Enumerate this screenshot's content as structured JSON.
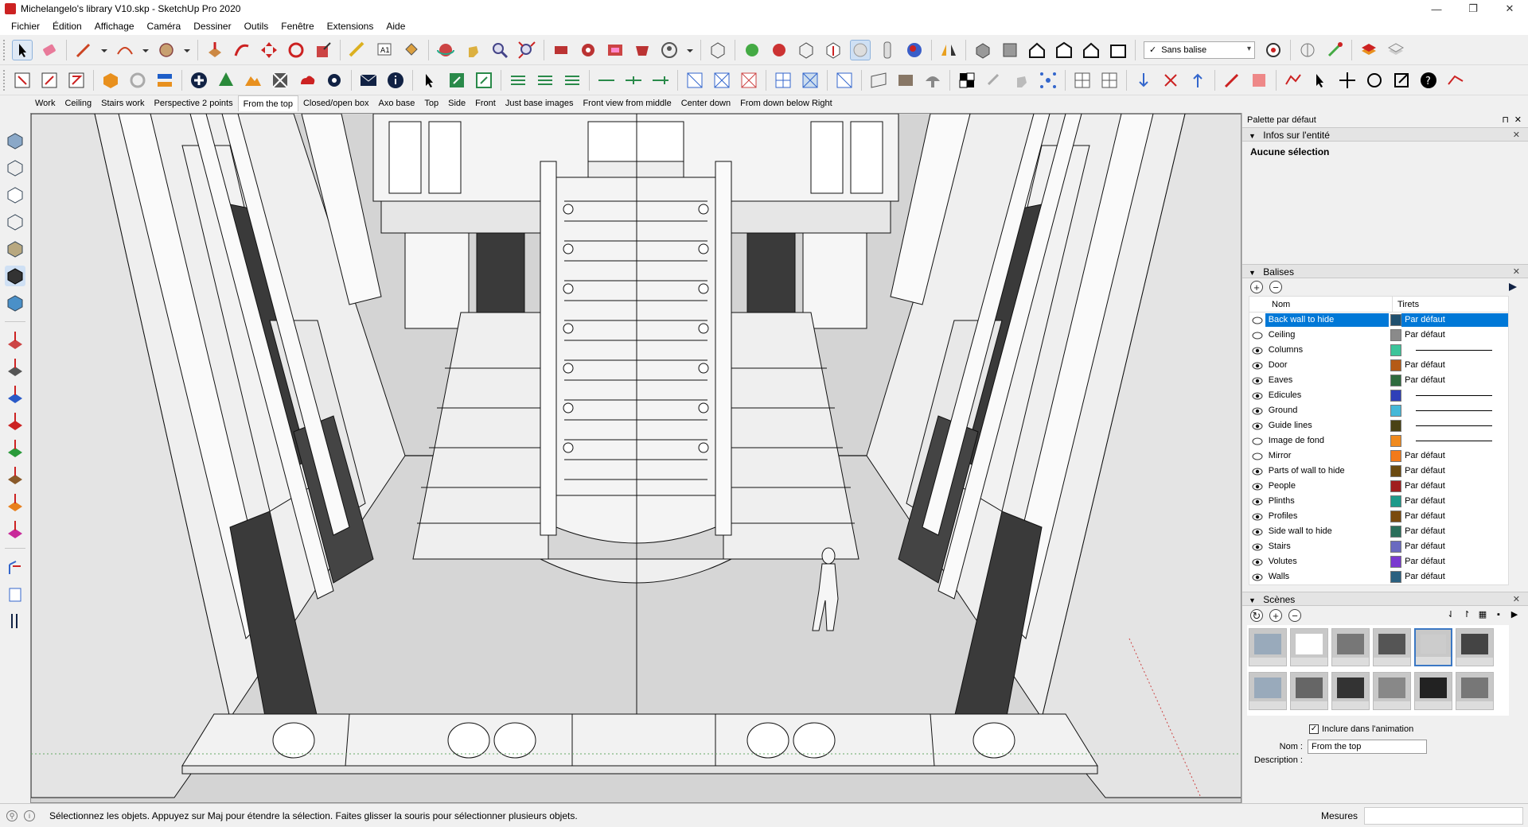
{
  "window": {
    "title": "Michelangelo's library V10.skp - SketchUp Pro 2020",
    "controls": [
      "—",
      "❐",
      "✕"
    ]
  },
  "menu": [
    "Fichier",
    "Édition",
    "Affichage",
    "Caméra",
    "Dessiner",
    "Outils",
    "Fenêtre",
    "Extensions",
    "Aide"
  ],
  "toolbar": {
    "tag_select_value": "Sans balise",
    "tag_select_check": "✓"
  },
  "scene_tabs": [
    "Work",
    "Ceiling",
    "Stairs work",
    "Perspective 2 points",
    "From the top",
    "Closed/open box",
    "Axo base",
    "Top",
    "Side",
    "Front",
    "Just base images",
    "Front view from middle",
    "Center down",
    "From down below Right"
  ],
  "active_scene_tab": "From the top",
  "panel": {
    "title": "Palette par défaut",
    "pin": "⊓",
    "close": "✕",
    "entity_info": {
      "header": "Infos sur l'entité",
      "body": "Aucune sélection"
    },
    "tags": {
      "header": "Balises",
      "add_btn": "+",
      "remove_btn": "−",
      "col_name": "Nom",
      "col_dashes": "Tirets",
      "rows": [
        {
          "name": "Back wall to hide",
          "visible": false,
          "color": "#1f4f6e",
          "dashes": "Par défaut",
          "selected": true
        },
        {
          "name": "Ceiling",
          "visible": false,
          "color": "#8a8a8a",
          "dashes": "Par défaut"
        },
        {
          "name": "Columns",
          "visible": true,
          "color": "#3cc49a",
          "dashes": ""
        },
        {
          "name": "Door",
          "visible": true,
          "color": "#b55a16",
          "dashes": "Par défaut"
        },
        {
          "name": "Eaves",
          "visible": true,
          "color": "#2e6b3e",
          "dashes": "Par défaut"
        },
        {
          "name": "Edicules",
          "visible": true,
          "color": "#2f3fb8",
          "dashes": ""
        },
        {
          "name": "Ground",
          "visible": true,
          "color": "#45b8d8",
          "dashes": ""
        },
        {
          "name": "Guide lines",
          "visible": true,
          "color": "#4a4214",
          "dashes": ""
        },
        {
          "name": "Image de fond",
          "visible": false,
          "color": "#f08a1e",
          "dashes": ""
        },
        {
          "name": "Mirror",
          "visible": false,
          "color": "#f27a1a",
          "dashes": "Par défaut"
        },
        {
          "name": "Parts of wall to hide",
          "visible": true,
          "color": "#6b4a10",
          "dashes": "Par défaut"
        },
        {
          "name": "People",
          "visible": true,
          "color": "#a01e1e",
          "dashes": "Par défaut"
        },
        {
          "name": "Plinths",
          "visible": true,
          "color": "#1e9a8a",
          "dashes": "Par défaut"
        },
        {
          "name": "Profiles",
          "visible": true,
          "color": "#7a4a0e",
          "dashes": "Par défaut"
        },
        {
          "name": "Side wall to hide",
          "visible": true,
          "color": "#2a6e5a",
          "dashes": "Par défaut"
        },
        {
          "name": "Stairs",
          "visible": true,
          "color": "#6a6ac0",
          "dashes": "Par défaut"
        },
        {
          "name": "Volutes",
          "visible": true,
          "color": "#7a3ad0",
          "dashes": "Par défaut"
        },
        {
          "name": "Walls",
          "visible": true,
          "color": "#2a6080",
          "dashes": "Par défaut"
        }
      ]
    },
    "scenes": {
      "header": "Scènes",
      "thumb_count": 12,
      "active_index": 4,
      "include_animation_label": "Inclure dans l'animation",
      "include_animation_checked": "✓",
      "name_label": "Nom :",
      "name_value": "From the top",
      "description_label": "Description :"
    }
  },
  "statusbar": {
    "message": "Sélectionnez les objets. Appuyez sur Maj pour étendre la sélection. Faites glisser la souris pour sélectionner plusieurs objets.",
    "measure_label": "Mesures"
  }
}
